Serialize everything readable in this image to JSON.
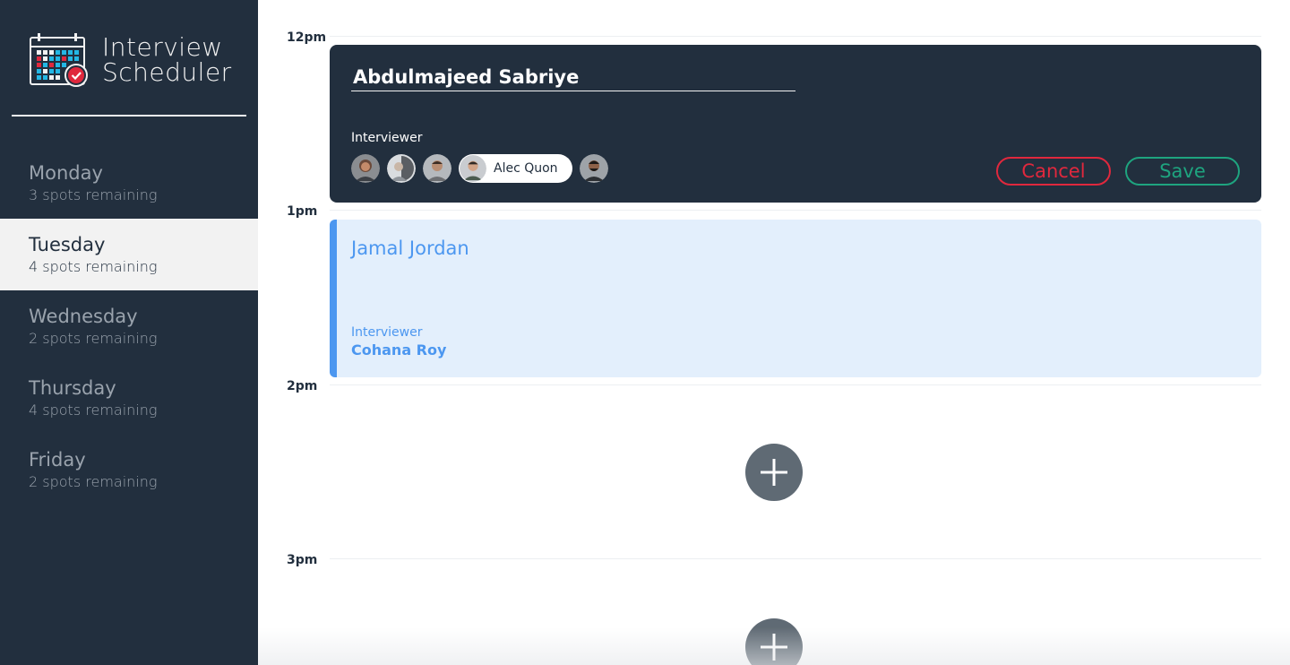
{
  "app": {
    "title_line1": "Interview",
    "title_line2": "Scheduler"
  },
  "sidebar": {
    "days": [
      {
        "name": "Monday",
        "spots": "3 spots remaining",
        "selected": false
      },
      {
        "name": "Tuesday",
        "spots": "4 spots remaining",
        "selected": true
      },
      {
        "name": "Wednesday",
        "spots": "2 spots remaining",
        "selected": false
      },
      {
        "name": "Thursday",
        "spots": "4 spots remaining",
        "selected": false
      },
      {
        "name": "Friday",
        "spots": "2 spots remaining",
        "selected": false
      }
    ]
  },
  "schedule": {
    "times": [
      "12pm",
      "1pm",
      "2pm",
      "3pm"
    ],
    "form": {
      "student_value": "Abdulmajeed Sabriye",
      "interviewer_label": "Interviewer",
      "selected_interviewer": "Alec Quon",
      "cancel_label": "Cancel",
      "save_label": "Save"
    },
    "show": {
      "student": "Jamal Jordan",
      "interviewer_label": "Interviewer",
      "interviewer_name": "Cohana Roy"
    }
  },
  "colors": {
    "sidebar_bg": "#222f3e",
    "selected_day_bg": "#f2f2f2",
    "cancel": "#e0283d",
    "save": "#1ea47f",
    "show_accent": "#4c97f0",
    "show_bg": "#e3effc",
    "add_button": "#5f6a74"
  },
  "icons": {
    "logo": "calendar-check-icon",
    "add": "plus-icon"
  }
}
